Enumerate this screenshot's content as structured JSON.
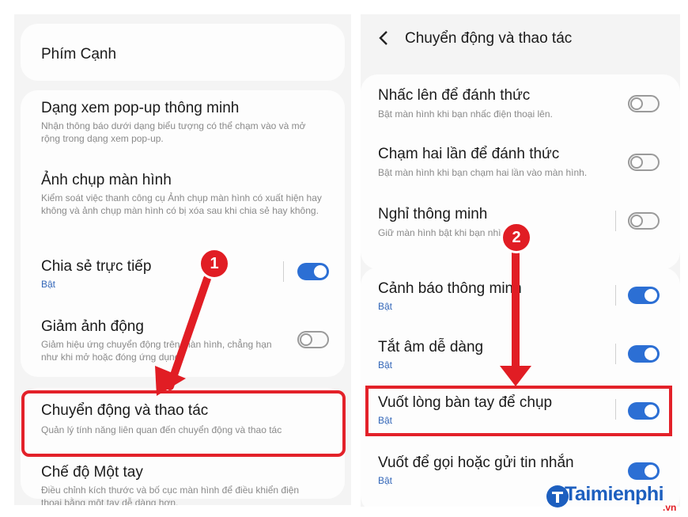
{
  "left": {
    "top_item": "Phím Cạnh",
    "items": [
      {
        "title": "Dạng xem pop-up thông minh",
        "desc": "Nhận thông báo dưới dạng biểu tượng có thể chạm vào và mở rộng trong dạng xem pop-up."
      },
      {
        "title": "Ảnh chụp màn hình",
        "desc": "Kiểm soát việc thanh công cụ Ảnh chụp màn hình có xuất hiện hay không và ảnh chụp màn hình có bị xóa sau khi chia sẻ hay không."
      },
      {
        "title": "Chia sẻ trực tiếp",
        "status": "Bật",
        "toggle": "on"
      },
      {
        "title": "Giảm ảnh động",
        "desc": "Giảm hiệu ứng chuyển động trên màn hình, chẳng hạn như khi mở hoặc đóng ứng dụng.",
        "toggle": "off"
      }
    ],
    "highlight_item": {
      "title": "Chuyển động và thao tác",
      "desc": "Quản lý tính năng liên quan đến chuyển động và thao tác"
    },
    "bottom_item": {
      "title": "Chế độ Một tay",
      "desc": "Điều chỉnh kích thước và bố cục màn hình để điều khiển điện thoại bằng một tay dễ dàng hơn."
    }
  },
  "right": {
    "header": {
      "back_icon": "chevron-left-icon",
      "title": "Chuyển động và thao tác"
    },
    "group1": [
      {
        "title": "Nhấc lên để đánh thức",
        "desc": "Bật màn hình khi bạn nhấc điện thoại lên.",
        "toggle": "off"
      },
      {
        "title": "Chạm hai lần để đánh thức",
        "desc": "Bật màn hình khi bạn chạm hai lần vào màn hình.",
        "toggle": "off"
      },
      {
        "title": "Nghỉ thông minh",
        "desc": "Giữ màn hình bật khi bạn nhìn vào.",
        "toggle": "off"
      }
    ],
    "group2": [
      {
        "title": "Cảnh báo thông minh",
        "status": "Bật",
        "toggle": "on"
      },
      {
        "title": "Tắt âm dễ dàng",
        "status": "Bật",
        "toggle": "on"
      },
      {
        "title": "Vuốt lòng bàn tay để chụp",
        "status": "Bật",
        "toggle": "on"
      },
      {
        "title": "Vuốt để gọi hoặc gửi tin nhắn",
        "status": "Bật",
        "toggle": "on"
      }
    ]
  },
  "annotations": {
    "step1": "1",
    "step2": "2"
  },
  "watermark": {
    "brand": "Taimienphi",
    "suffix": ".vn"
  },
  "colors": {
    "toggle_on": "#2c6fd4",
    "highlight": "#e32129",
    "badge": "#e11d24",
    "status": "#3266b8"
  }
}
